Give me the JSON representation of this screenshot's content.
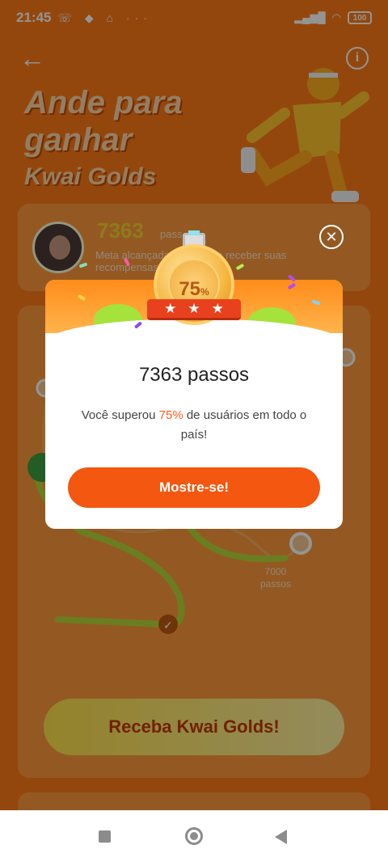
{
  "status_bar": {
    "time": "21:45",
    "notif_icons": "☏ ◆ ⌂ ···",
    "battery": "100"
  },
  "header": {
    "title_line1": "Ande para",
    "title_line2": "ganhar",
    "title_line3": "Kwai Golds"
  },
  "profile_card": {
    "steps": "7363",
    "steps_unit": "pass",
    "meta_text": "Meta alcançada! Volte para receber suas recompensas"
  },
  "progress_card": {
    "milestone_steps": "7000",
    "milestone_unit": "passos",
    "receive_button": "Receba Kwai Golds!"
  },
  "popup": {
    "percent": "75",
    "percent_sign": "%",
    "steps_text": "7363 passos",
    "desc_before": "Você superou ",
    "desc_percent": "75%",
    "desc_after": " de usuários em todo o país!",
    "button": "Mostre-se!",
    "stars": [
      "★",
      "★",
      "★"
    ]
  },
  "colors": {
    "accent": "#f4570f",
    "highlight": "#ff5a1a",
    "app_bg": "#ff7a18"
  }
}
